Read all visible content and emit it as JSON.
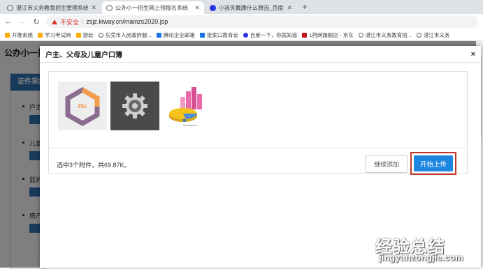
{
  "browser": {
    "tabs": [
      {
        "title": "湛江市义务教育招生管理系统",
        "active": false
      },
      {
        "title": "公办小一招生网上预报名系统",
        "active": true
      },
      {
        "title": "小孩失戴腰什么原因_百度搜索",
        "active": false
      }
    ],
    "url": {
      "security_label": "不安全",
      "separator": "|",
      "address": "zsjz.kiway.cn/mainzs2020.jsp"
    },
    "bookmarks": [
      {
        "label": "开推系统",
        "icon": "folder-icon"
      },
      {
        "label": "学习考试网",
        "icon": "folder-icon"
      },
      {
        "label": "游玩",
        "icon": "folder-icon"
      },
      {
        "label": "东莞市人民政府服...",
        "icon": "globe-icon"
      },
      {
        "label": "腾讯企业邮箱",
        "icon": "mail-icon"
      },
      {
        "label": "张家口教育云",
        "icon": "cloud-icon"
      },
      {
        "label": "百度一下，你就知道",
        "icon": "baidu-icon"
      },
      {
        "label": "1药网旗舰店 - 京东",
        "icon": "jd-icon"
      },
      {
        "label": "湛江市义务教育招...",
        "icon": "globe-icon"
      },
      {
        "label": "湛江市义务",
        "icon": "globe-icon"
      }
    ]
  },
  "page": {
    "title": "公办小一报",
    "left_panel": {
      "header": "证件采集",
      "items": [
        "户主",
        "儿童",
        "监护",
        "房产"
      ]
    }
  },
  "modal": {
    "title": "户主、父母及儿童户口簿",
    "close_label": "×",
    "thumbs": [
      {
        "name": "thumb-hexagon-35z",
        "text": "35z"
      },
      {
        "name": "thumb-gear"
      },
      {
        "name": "thumb-3d-chart"
      }
    ],
    "status_text": "选中3个附件，共69.87K。",
    "continue_label": "继续添加",
    "upload_label": "开始上传"
  },
  "watermark": {
    "main": "经验总结",
    "sub": "jingyanzongjie.com"
  },
  "colors": {
    "primary": "#1b87e0",
    "header_blue": "#2e75b6",
    "highlight_red": "#c0392b",
    "warning_red": "#d93025"
  }
}
